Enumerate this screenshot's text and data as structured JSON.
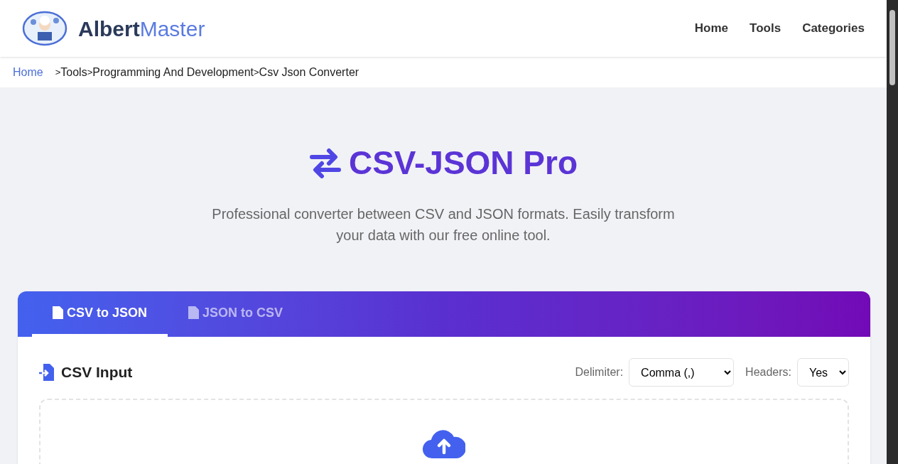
{
  "header": {
    "brand": {
      "part1": "Albert",
      "part2": "Master"
    },
    "nav": [
      "Home",
      "Tools",
      "Categories"
    ]
  },
  "breadcrumb": [
    {
      "label": "Home",
      "kind": "link"
    },
    {
      "separator": ">",
      "label": "Tools",
      "kind": "text"
    },
    {
      "separator": ">",
      "label": "Programming And Development",
      "kind": "text"
    },
    {
      "separator": ">",
      "label": "Csv Json Converter",
      "kind": "text"
    }
  ],
  "hero": {
    "title": "CSV-JSON Pro",
    "subtitle": "Professional converter between CSV and JSON formats. Easily transform your data with our free online tool."
  },
  "tabs": [
    {
      "label": "CSV to JSON",
      "selected": true
    },
    {
      "label": "JSON to CSV",
      "selected": false
    }
  ],
  "panel": {
    "title": "CSV Input",
    "delimiter": {
      "label": "Delimiter:",
      "value": "Comma (,)"
    },
    "headers": {
      "label": "Headers:",
      "value": "Yes"
    }
  }
}
